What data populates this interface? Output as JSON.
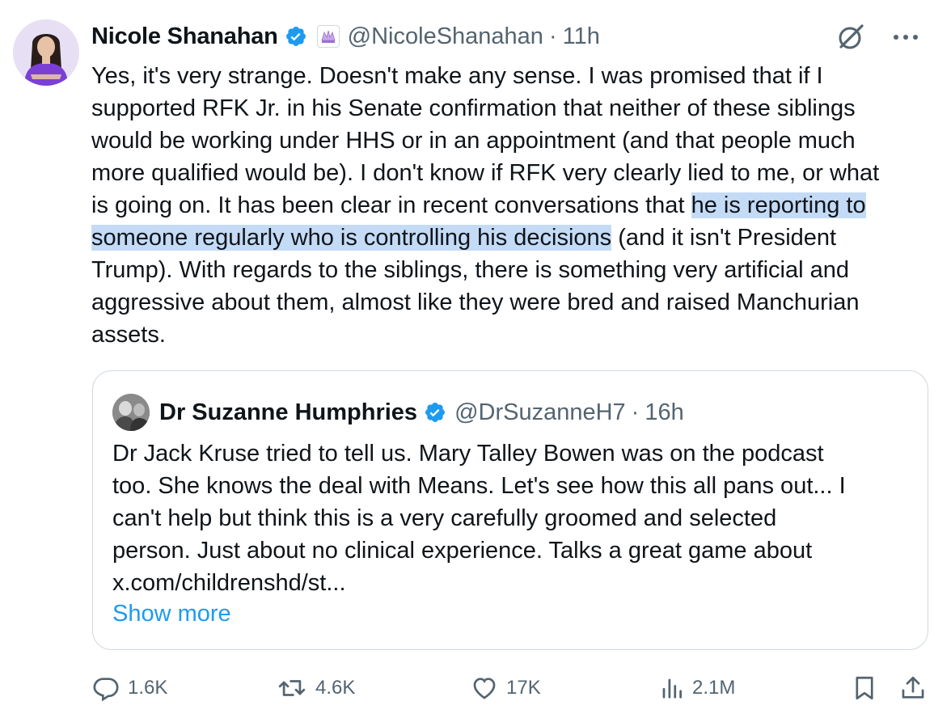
{
  "tweet": {
    "author_name": "Nicole Shanahan",
    "handle": "@NicoleShanahan",
    "separator": "·",
    "time": "11h",
    "text_before": "Yes, it's very strange. Doesn't make any sense. I was promised that if I\nsupported RFK Jr. in his Senate confirmation that neither of these siblings\nwould be working under HHS or in an appointment (and that people much\nmore qualified would be). I don't know if RFK very clearly lied to me, or what\nis going on. It has been clear in recent conversations that ",
    "text_highlight": "he is reporting to\nsomeone regularly who is controlling his decisions",
    "text_after": " (and it isn't President\nTrump). With regards to the siblings, there is something very artificial and\naggressive about them, almost like they were bred and raised Manchurian\nassets.",
    "icons": {
      "verified": "verified-badge-icon",
      "affiliate": "affiliate-badge-icon",
      "grok": "grok-icon",
      "more": "more-options-icon"
    }
  },
  "quote": {
    "author_name": "Dr Suzanne Humphries",
    "handle": "@DrSuzanneH7",
    "separator": "·",
    "time": "16h",
    "text": "Dr Jack Kruse tried to tell us. Mary Talley Bowen was on the podcast\ntoo. She knows the deal with Means. Let's see how this all pans out... I\ncan't help but think this is a very carefully groomed and selected\nperson. Just about no clinical experience. Talks a great game about\nx.com/childrenshd/st...",
    "show_more": "Show more"
  },
  "actions": {
    "replies": "1.6K",
    "reposts": "4.6K",
    "likes": "17K",
    "views": "2.1M",
    "icons": [
      "reply-icon",
      "repost-icon",
      "like-icon",
      "views-icon",
      "bookmark-icon",
      "share-icon"
    ]
  },
  "colors": {
    "text": "#0f1419",
    "secondary": "#536471",
    "accent": "#1d9bf0",
    "highlight": "#c4dbf6",
    "border": "#cfd9de"
  }
}
